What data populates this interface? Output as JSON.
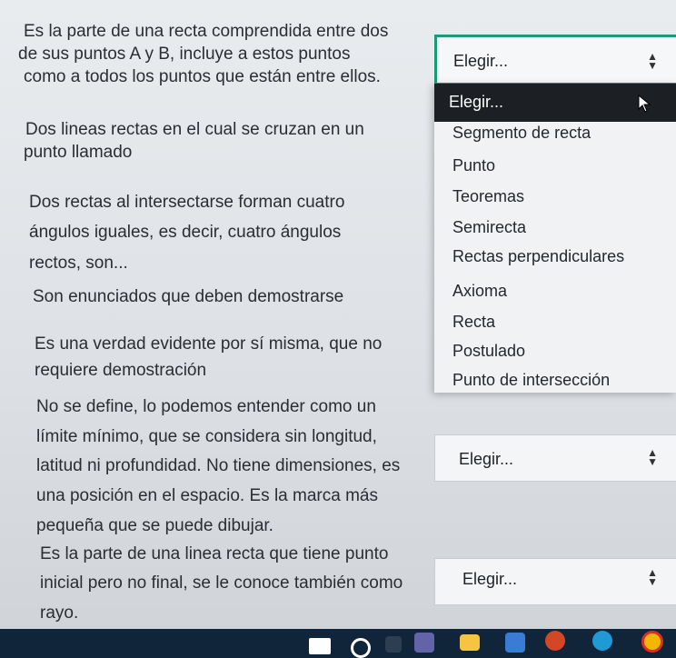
{
  "questions": [
    {
      "lines": [
        "Es la parte de una recta comprendida entre dos",
        "de sus puntos A y B, incluye a estos puntos",
        "como a todos los puntos que están entre ellos."
      ]
    },
    {
      "lines": [
        "Dos lineas rectas en el cual se cruzan en un",
        "punto llamado"
      ]
    },
    {
      "lines": [
        "Dos rectas al intersectarse forman cuatro",
        "ángulos iguales, es decir, cuatro ángulos",
        "rectos, son..."
      ]
    },
    {
      "lines": [
        "Son enunciados que deben demostrarse"
      ]
    },
    {
      "lines": [
        "Es una verdad evidente por sí misma, que no",
        "requiere demostración"
      ]
    },
    {
      "lines": [
        "No se define, lo podemos entender como un",
        "límite mínimo, que se considera sin longitud,",
        "latitud ni profundidad. No tiene dimensiones, es",
        "una posición en el espacio. Es la marca más",
        "pequeña que se puede dibujar."
      ]
    },
    {
      "lines": [
        "Es la parte de una linea recta que tiene punto",
        "inicial pero no final, se le conoce también como",
        "rayo."
      ]
    }
  ],
  "selects": [
    {
      "value": "Elegir..."
    },
    {
      "value": "Elegir..."
    },
    {
      "value": "Elegir..."
    }
  ],
  "dropdown": {
    "options": [
      "Elegir...",
      "Segmento de recta",
      "Punto",
      "Teoremas",
      "Semirecta",
      "Rectas perpendiculares",
      "Axioma",
      "Recta",
      "Postulado",
      "Punto de intersección"
    ],
    "highlighted_index": 0
  },
  "taskbar": {
    "icons": [
      "windows-start-icon",
      "search-icon",
      "task-view-icon",
      "teams-icon",
      "file-explorer-icon",
      "store-icon",
      "powerpoint-icon",
      "edge-icon",
      "chrome-icon"
    ],
    "colors": {
      "background": "#10243a",
      "accent": "#1c9a78"
    }
  }
}
